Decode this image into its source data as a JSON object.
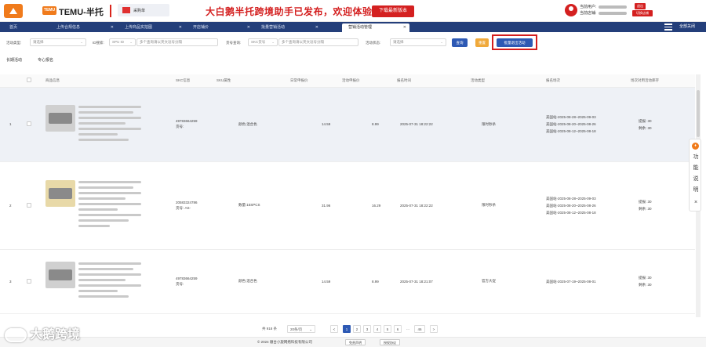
{
  "header": {
    "brand_badge": "TEMU",
    "brand_name": "TEMU-半托",
    "flag_button_label": "采购单",
    "promo_text": "大白鹅半托跨境助手已发布，欢迎体验！！",
    "download_label": "下载最新版本",
    "user_label": "当前用户:",
    "shop_label": "当前店铺:",
    "logout_label": "退出",
    "switch_shop_label": "切换店铺"
  },
  "tabs": [
    {
      "label": "首页",
      "closable": false
    },
    {
      "label": "上传合规信息",
      "closable": true
    },
    {
      "label": "上传商品实拍图",
      "closable": true
    },
    {
      "label": "开店铺价",
      "closable": true
    },
    {
      "label": "批量营销活动",
      "closable": true
    },
    {
      "label": "营销活动管理",
      "closable": true,
      "active": true
    }
  ],
  "close_all_label": "全部关闭",
  "filters": {
    "activity_type_label": "活动类型:",
    "activity_type_value": "请选择",
    "id_search_label": "ID搜索:",
    "id_type_value": "SPU ID",
    "id_input_placeholder": "多个查询请以英文逗号分隔",
    "sku_search_label": "货号查询:",
    "sku_type_value": "SKC货号",
    "sku_input_placeholder": "多个查询请以英文逗号分隔",
    "status_label": "活动状态:",
    "status_value": "请选择",
    "query_button": "查询",
    "reset_button": "重置",
    "batch_exit_button": "批量退出活动"
  },
  "subtabs": [
    "长期活动",
    "专心报名"
  ],
  "table": {
    "columns": [
      "",
      "",
      "商品信息",
      "SKC信息",
      "SKU属性",
      "日常申报价",
      "活动申报价",
      "报名时间",
      "活动类型",
      "报名场次",
      "场次对用活动库存"
    ],
    "rows": [
      {
        "index": "1",
        "skc_id": "49783664259",
        "skc_code_label": "货号:",
        "sku_attr": "颜色:混合色",
        "daily_price": "14.59",
        "activity_price": "8.99",
        "signup_time": "2025-07-31 18:22:22",
        "activity_type": "限时秒杀",
        "sessions": [
          "美国站-2025-08-28~2025-09-03",
          "美国站-2025-08-20~2025-08-26",
          "美国站-2025-08-12~2025-08-18"
        ],
        "stock_lines": [
          "提报: 30",
          "剩余: 30"
        ]
      },
      {
        "index": "2",
        "skc_id": "20583324786",
        "skc_code_label": "货号: AS-",
        "sku_attr": "数量:15SPCS",
        "daily_price": "31.96",
        "activity_price": "16.29",
        "signup_time": "2025-07-31 18:22:22",
        "activity_type": "限时秒杀",
        "sessions": [
          "美国站-2025-08-28~2025-09-03",
          "美国站-2025-08-20~2025-08-26",
          "美国站-2025-08-12~2025-08-18"
        ],
        "stock_lines": [
          "提报: 30",
          "剩余: 30"
        ]
      },
      {
        "index": "3",
        "skc_id": "49783664259",
        "skc_code_label": "货号:",
        "sku_attr": "颜色:混合色",
        "daily_price": "14.59",
        "activity_price": "8.99",
        "signup_time": "2025-07-31 18:21:07",
        "activity_type": "官方大促",
        "sessions": [
          "美国站-2025-07-19~2025-08-01"
        ],
        "stock_lines": [
          "提报: 30",
          "剩余: 30"
        ]
      }
    ]
  },
  "side_help": {
    "icon": "help-icon",
    "text": "功能说明",
    "close": "×"
  },
  "pagination": {
    "total_label": "共 918 条",
    "page_size": "20条/页",
    "pages": [
      "1",
      "2",
      "3",
      "4",
      "5",
      "6",
      "...",
      "46"
    ],
    "current": "1",
    "prev": "<",
    "next": ">"
  },
  "footer": {
    "copyright": "© 2024 顺台小旋网络科技有限公司",
    "disclaimer": "免责声明",
    "license": "授权协议"
  },
  "watermark": "大鹅跨境",
  "colors": {
    "brand_orange": "#f07b1c",
    "accent_red": "#d42020",
    "nav_blue": "#243f7a",
    "primary_blue": "#2d59b4"
  }
}
